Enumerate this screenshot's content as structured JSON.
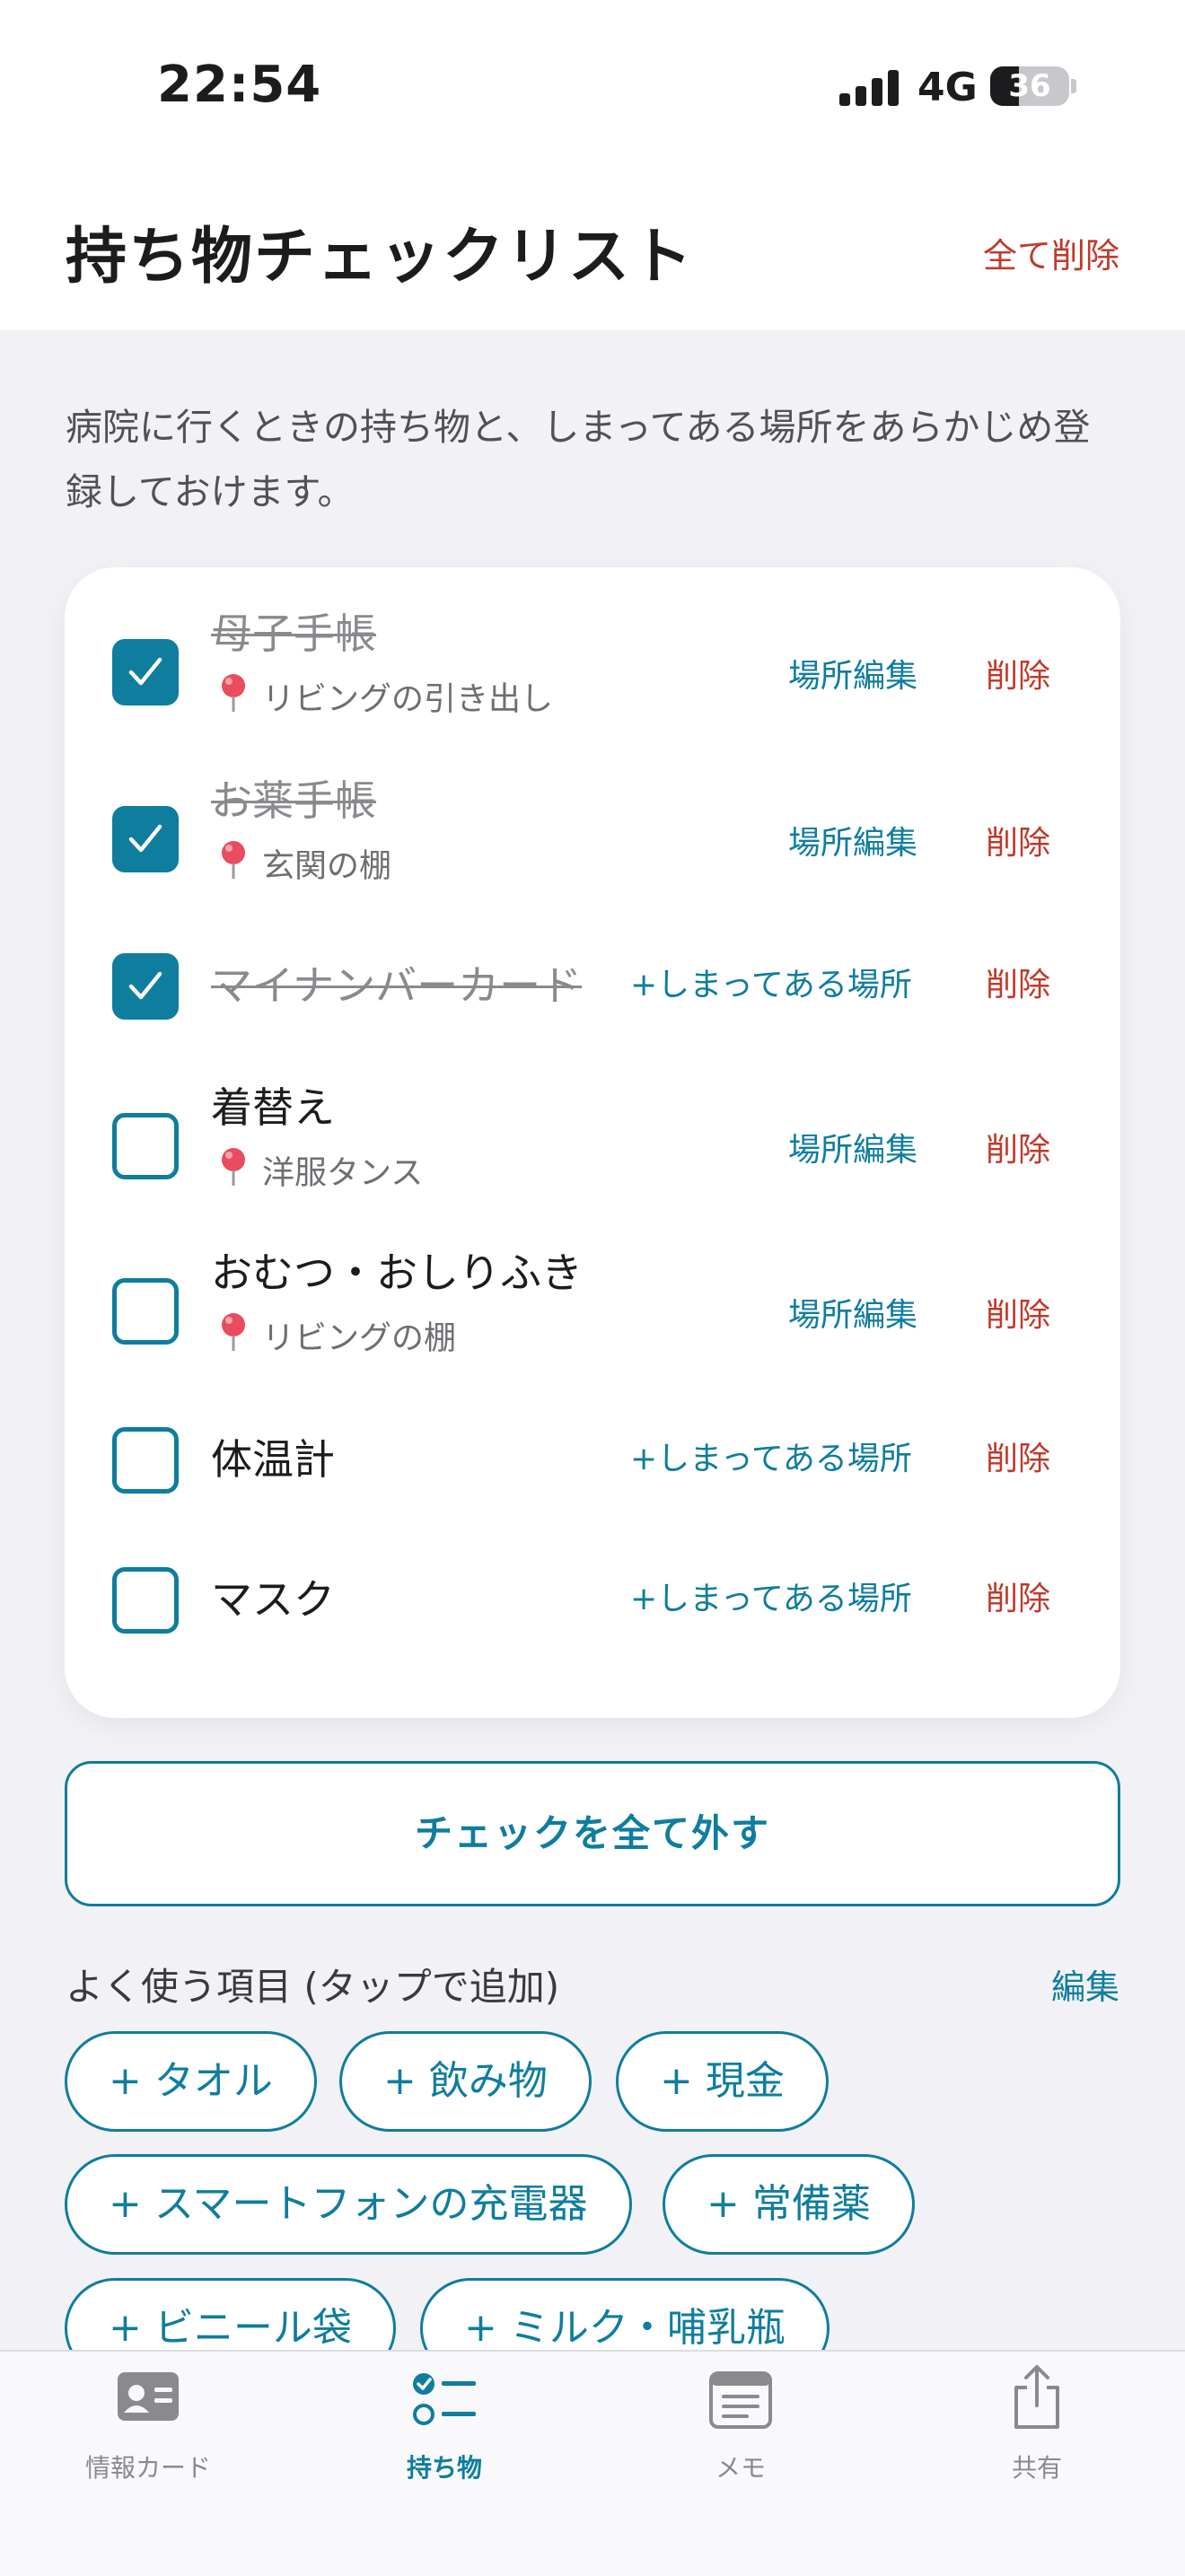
{
  "status_bar": {
    "time": "22:54",
    "network": "4G",
    "battery": "36",
    "battery_level": 0.36
  },
  "header": {
    "title": "持ち物チェックリスト",
    "delete_all": "全て削除"
  },
  "description": "病院に行くときの持ち物と、しまってある場所をあらかじめ登録しておけます。",
  "checklist": {
    "items": [
      {
        "name": "母子手帳",
        "checked": true,
        "location": "リビングの引き出し",
        "action": "場所編集",
        "delete": "削除"
      },
      {
        "name": "お薬手帳",
        "checked": true,
        "location": "玄関の棚",
        "action": "場所編集",
        "delete": "削除"
      },
      {
        "name": "マイナンバーカード",
        "checked": true,
        "location": null,
        "action": "+しまってある場所",
        "delete": "削除"
      },
      {
        "name": "着替え",
        "checked": false,
        "location": "洋服タンス",
        "action": "場所編集",
        "delete": "削除"
      },
      {
        "name": "おむつ・おしりふき",
        "checked": false,
        "location": "リビングの棚",
        "action": "場所編集",
        "delete": "削除"
      },
      {
        "name": "体温計",
        "checked": false,
        "location": null,
        "action": "+しまってある場所",
        "delete": "削除"
      },
      {
        "name": "マスク",
        "checked": false,
        "location": null,
        "action": "+しまってある場所",
        "delete": "削除"
      }
    ]
  },
  "uncheck_all": "チェックを全て外す",
  "frequent": {
    "title": "よく使う項目 (タップで追加)",
    "edit": "編集",
    "plus": "+",
    "items": [
      "タオル",
      "飲み物",
      "現金",
      "スマートフォンの充電器",
      "常備薬",
      "ビニール袋",
      "ミルク・哺乳瓶"
    ]
  },
  "tabs": [
    {
      "label": "情報カード",
      "icon": "id-card-icon",
      "active": false
    },
    {
      "label": "持ち物",
      "icon": "checklist-icon",
      "active": true
    },
    {
      "label": "メモ",
      "icon": "memo-icon",
      "active": false
    },
    {
      "label": "共有",
      "icon": "share-icon",
      "active": false
    }
  ],
  "colors": {
    "accent": "#0f7d9e",
    "danger": "#c0392b",
    "background": "#f1f1f6"
  }
}
